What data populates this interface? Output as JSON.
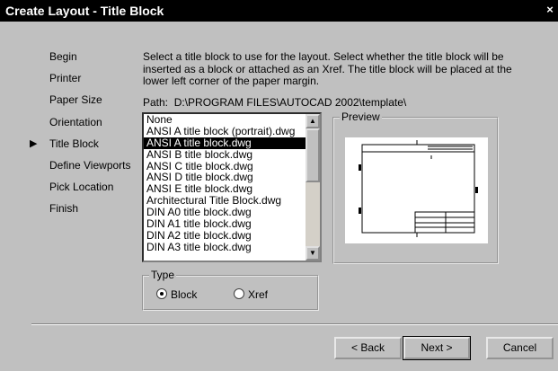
{
  "window": {
    "title": "Create Layout - Title Block",
    "close_glyph": "×"
  },
  "steps": {
    "current_marker": "▶",
    "items": [
      {
        "label": "Begin"
      },
      {
        "label": "Printer"
      },
      {
        "label": "Paper Size"
      },
      {
        "label": "Orientation"
      },
      {
        "label": "Title Block"
      },
      {
        "label": "Define Viewports"
      },
      {
        "label": "Pick Location"
      },
      {
        "label": "Finish"
      }
    ]
  },
  "description": "Select a title block to use for the layout. Select whether the title block will be inserted as a block or attached as an Xref. The title block will be placed at the lower left corner of the paper margin.",
  "path": {
    "label": "Path:",
    "value": "D:\\PROGRAM FILES\\AUTOCAD 2002\\template\\"
  },
  "title_blocks": {
    "items": [
      "None",
      "ANSI A title block (portrait).dwg",
      "ANSI A title block.dwg",
      "ANSI B title block.dwg",
      "ANSI C title block.dwg",
      "ANSI D title block.dwg",
      "ANSI E title block.dwg",
      "Architectural Title Block.dwg",
      "DIN A0 title block.dwg",
      "DIN A1 title block.dwg",
      "DIN A2 title block.dwg",
      "DIN A3 title block.dwg"
    ],
    "selected": "ANSI A title block.dwg",
    "scroll_up_icon": "▲",
    "scroll_down_icon": "▼"
  },
  "preview": {
    "label": "Preview"
  },
  "type": {
    "label": "Type",
    "options": [
      {
        "label": "Block",
        "selected": true
      },
      {
        "label": "Xref",
        "selected": false
      }
    ]
  },
  "buttons": {
    "back": "< Back",
    "next": "Next >",
    "cancel": "Cancel"
  }
}
